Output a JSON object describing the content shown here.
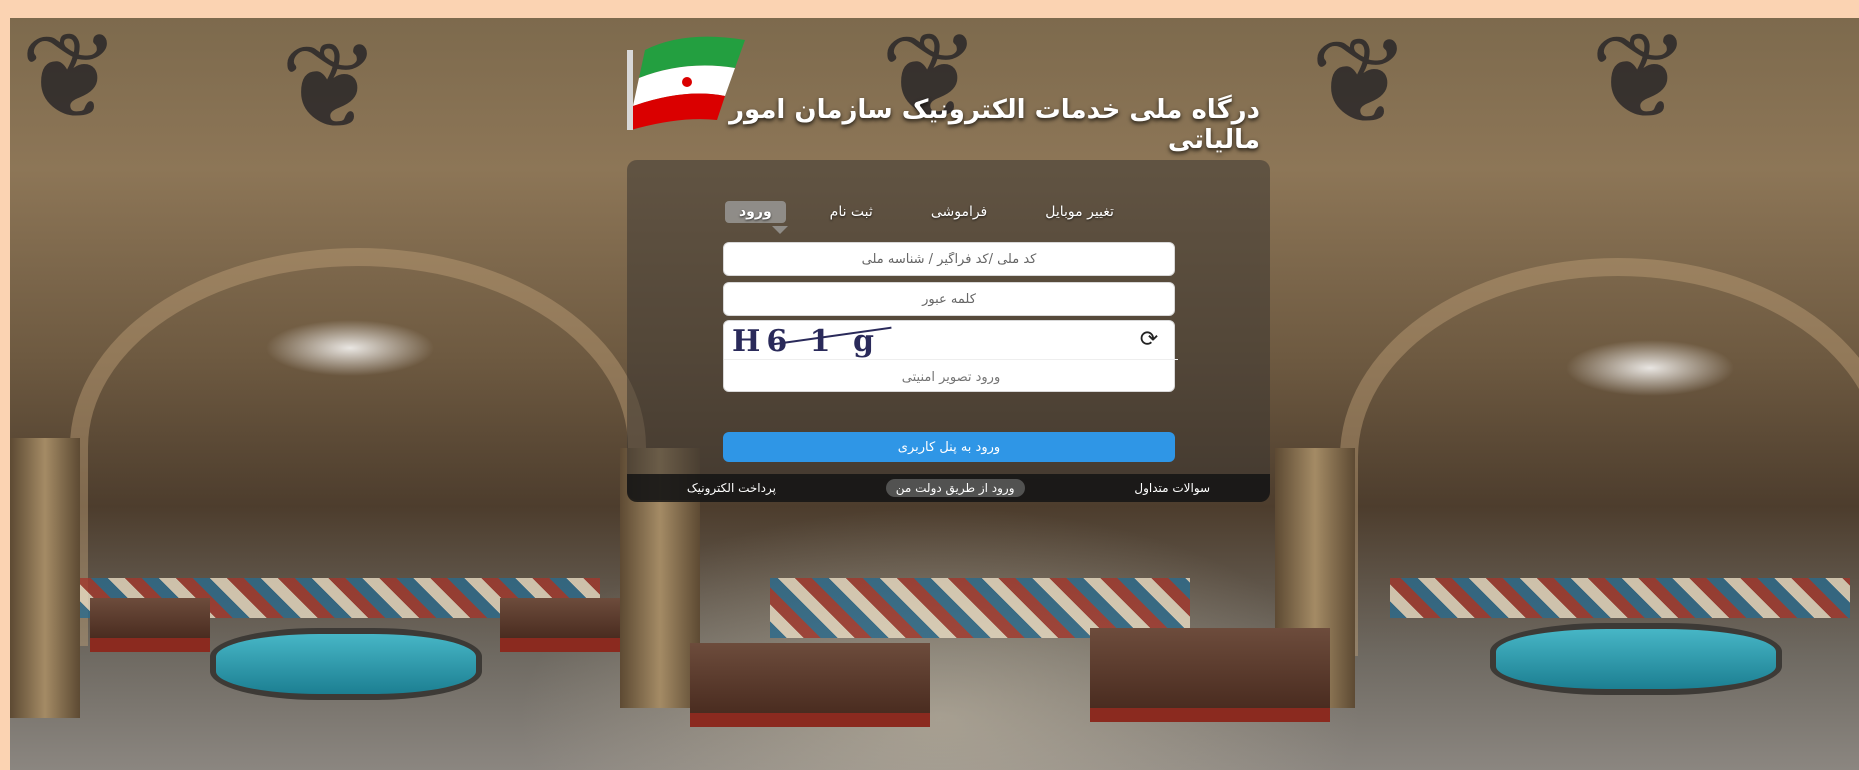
{
  "header": {
    "title": "درگاه ملی خدمات الکترونیک سازمان امور مالیاتی",
    "flag_icon": "iran-flag-icon"
  },
  "tabs": [
    {
      "label": "ورود",
      "active": true
    },
    {
      "label": "ثبت نام",
      "active": false
    },
    {
      "label": "فراموشی",
      "active": false
    },
    {
      "label": "تغییر موبایل",
      "active": false
    }
  ],
  "form": {
    "username_placeholder": "کد ملی /کد فراگیر / شناسه ملی",
    "username_value": "",
    "password_placeholder": "کلمه عبور",
    "password_value": "",
    "captcha_text": "H6 1 g",
    "captcha_refresh_icon": "refresh-icon",
    "captcha_placeholder": "ورود تصویر امنیتی",
    "captcha_value": "",
    "submit_label": "ورود به پنل کاربری"
  },
  "bottom_links": [
    {
      "label": "پرداخت الکترونیک"
    },
    {
      "label": "ورود از طریق دولت من"
    },
    {
      "label": "سوالات متداول"
    }
  ],
  "colors": {
    "accent": "#2f96e6",
    "border": "#fbd3b2"
  }
}
